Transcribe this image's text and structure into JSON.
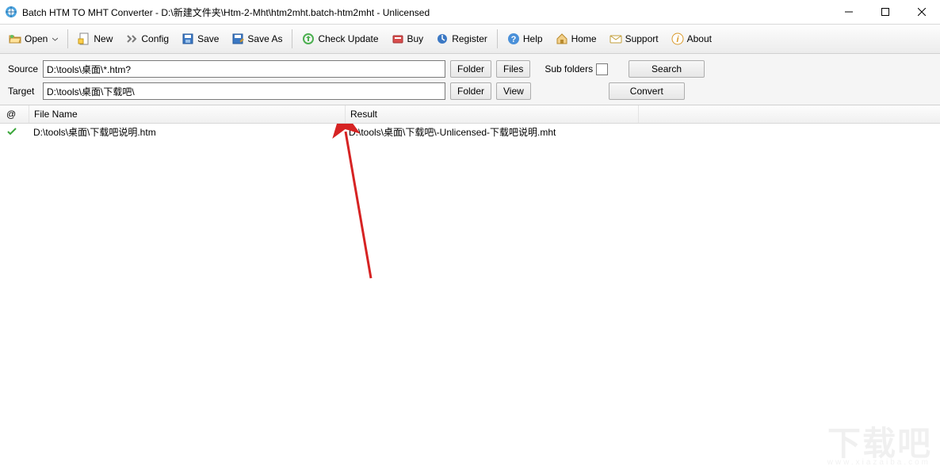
{
  "window": {
    "title": "Batch HTM TO MHT Converter - D:\\新建文件夹\\Htm-2-Mht\\htm2mht.batch-htm2mht - Unlicensed"
  },
  "toolbar": {
    "open": "Open",
    "new": "New",
    "config": "Config",
    "save": "Save",
    "save_as": "Save As",
    "check_update": "Check Update",
    "buy": "Buy",
    "register": "Register",
    "help": "Help",
    "home": "Home",
    "support": "Support",
    "about": "About"
  },
  "paths": {
    "source_label": "Source",
    "target_label": "Target",
    "source_value": "D:\\tools\\桌面\\*.htm?",
    "target_value": "D:\\tools\\桌面\\下载吧\\",
    "folder_btn": "Folder",
    "files_btn": "Files",
    "view_btn": "View",
    "sub_folders_label": "Sub folders",
    "search_btn": "Search",
    "convert_btn": "Convert"
  },
  "list": {
    "col_at": "@",
    "col_file": "File Name",
    "col_result": "Result",
    "rows": [
      {
        "status": "ok",
        "file": "D:\\tools\\桌面\\下载吧说明.htm",
        "result": "D:\\tools\\桌面\\下载吧\\-Unlicensed-下载吧说明.mht"
      }
    ]
  },
  "watermark": {
    "big": "下载吧",
    "small": "www.xiazaiba.com"
  }
}
